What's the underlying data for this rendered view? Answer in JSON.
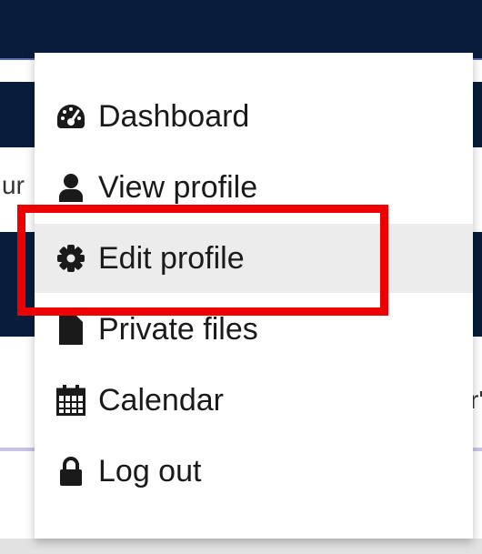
{
  "background": {
    "left_fragment_text": "ur",
    "right_fragment_text": "r'"
  },
  "menu": {
    "items": [
      {
        "label": "Dashboard",
        "icon": "dashboard-gauge-icon"
      },
      {
        "label": "View profile",
        "icon": "user-icon"
      },
      {
        "label": "Edit profile",
        "icon": "gear-icon",
        "highlighted": true
      },
      {
        "label": "Private files",
        "icon": "file-icon"
      },
      {
        "label": "Calendar",
        "icon": "calendar-icon"
      },
      {
        "label": "Log out",
        "icon": "lock-icon"
      }
    ]
  },
  "colors": {
    "navbar": "#071d3b",
    "highlight_border": "#ee0000",
    "active_item_bg": "#ececec"
  }
}
